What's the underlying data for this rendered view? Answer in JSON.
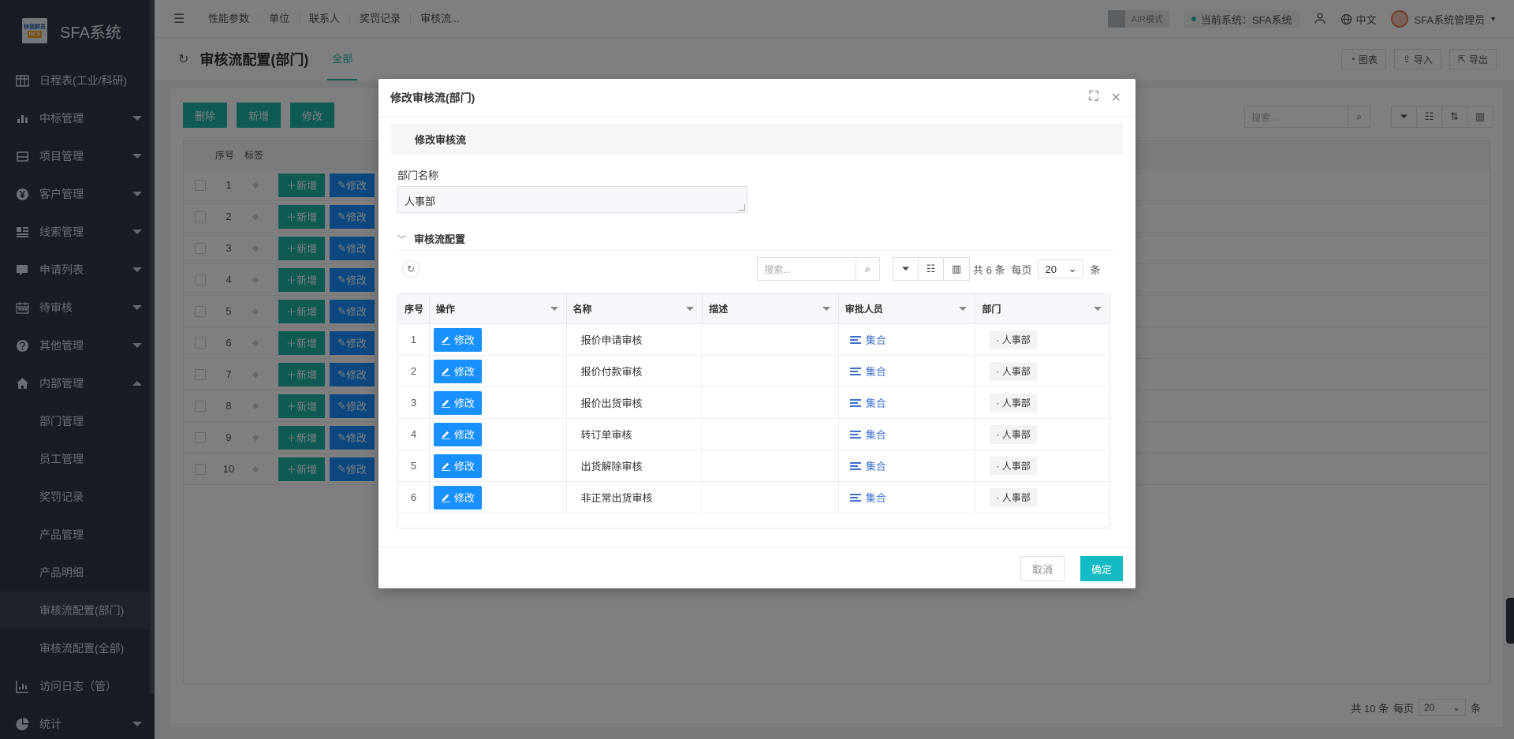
{
  "app": {
    "title": "SFA系统",
    "logo_line1": "快我群员",
    "logo_line2": "NCS"
  },
  "sidebar": {
    "items": [
      {
        "label": "日程表(工业/科研)",
        "icon": "calendar-table-icon",
        "expand": "none"
      },
      {
        "label": "中标管理",
        "icon": "bar-chart-icon",
        "expand": "down"
      },
      {
        "label": "项目管理",
        "icon": "hdd-icon",
        "expand": "down"
      },
      {
        "label": "客户管理",
        "icon": "yen-circle-icon",
        "expand": "down"
      },
      {
        "label": "线索管理",
        "icon": "list-grid-icon",
        "expand": "down"
      },
      {
        "label": "申请列表",
        "icon": "edit-list-icon",
        "expand": "down"
      },
      {
        "label": "待审核",
        "icon": "calendar-icon",
        "expand": "down"
      },
      {
        "label": "其他管理",
        "icon": "question-circle-icon",
        "expand": "down"
      },
      {
        "label": "内部管理",
        "icon": "home-icon",
        "expand": "up"
      }
    ],
    "subitems": [
      {
        "label": "部门管理",
        "active": false
      },
      {
        "label": "员工管理",
        "active": false
      },
      {
        "label": "奖罚记录",
        "active": false
      },
      {
        "label": "产品管理",
        "active": false
      },
      {
        "label": "产品明细",
        "active": false
      },
      {
        "label": "审核流配置(部门)",
        "active": true
      },
      {
        "label": "审核流配置(全部)",
        "active": false
      }
    ],
    "tail": [
      {
        "label": "访问日志（管）",
        "icon": "line-chart-icon",
        "expand": "none"
      },
      {
        "label": "统计",
        "icon": "pie-chart-icon",
        "expand": "down"
      }
    ]
  },
  "topbar": {
    "links": [
      "性能参数",
      "单位",
      "联系人",
      "奖罚记录",
      "审核流..."
    ],
    "air_mode": "AIR模式",
    "current_system": "当前系统：SFA系统",
    "language": "中文",
    "user": "SFA系统管理员"
  },
  "pagehead": {
    "title": "审核流配置(部门)",
    "tab": "全部",
    "actions": [
      "图表",
      "导入",
      "导出"
    ]
  },
  "content": {
    "buttons": [
      "删除",
      "新增",
      "修改"
    ],
    "search_placeholder": "搜索...",
    "columns": [
      "序号",
      "标签"
    ],
    "row_add": "新增",
    "row_mod": "修改",
    "rows": [
      "1",
      "2",
      "3",
      "4",
      "5",
      "6",
      "7",
      "8",
      "9",
      "10"
    ],
    "pager": {
      "total": "共 10 条",
      "per_page": "每页",
      "size": "20",
      "unit": "条"
    }
  },
  "modal": {
    "title": "修改审核流(部门)",
    "section": "修改审核流",
    "dept_label": "部门名称",
    "dept_value": "人事部",
    "subsection": "审核流配置",
    "search_placeholder": "搜索...",
    "pager": {
      "total": "共 6 条",
      "per_page": "每页",
      "size": "20",
      "unit": "条"
    },
    "columns": [
      "序号",
      "操作",
      "名称",
      "描述",
      "审批人员",
      "部门"
    ],
    "edit_label": "修改",
    "approver_label": "集合",
    "rows": [
      {
        "no": "1",
        "name": "报价申请审核",
        "desc": "",
        "dept": "· 人事部"
      },
      {
        "no": "2",
        "name": "报价付款审核",
        "desc": "",
        "dept": "· 人事部"
      },
      {
        "no": "3",
        "name": "报价出货审核",
        "desc": "",
        "dept": "· 人事部"
      },
      {
        "no": "4",
        "name": "转订单审核",
        "desc": "",
        "dept": "· 人事部"
      },
      {
        "no": "5",
        "name": "出货解除审核",
        "desc": "",
        "dept": "· 人事部"
      },
      {
        "no": "6",
        "name": "非正常出货审核",
        "desc": "",
        "dept": "· 人事部"
      }
    ],
    "cancel": "取消",
    "confirm": "确定"
  },
  "colors": {
    "sidebar_bg": "#2f3a47",
    "accent_teal": "#1fb6a8",
    "edit_blue": "#1890ff",
    "confirm": "#13bcc4"
  }
}
